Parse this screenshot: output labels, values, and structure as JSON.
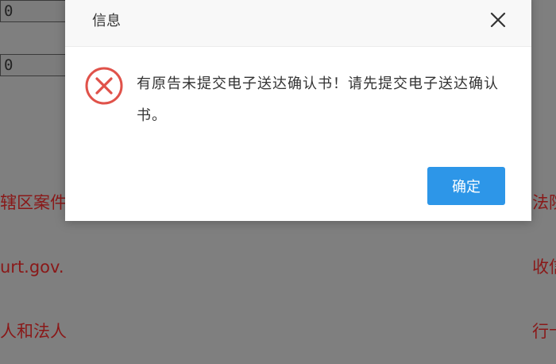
{
  "background": {
    "input_1_value": "0",
    "input_2_value": "0",
    "left_lines": [
      "辖区案件",
      "urt.gov.",
      "人和法人"
    ],
    "right_lines": [
      "法院",
      "收信",
      "行卡"
    ]
  },
  "dialog": {
    "title": "信息",
    "message": "有原告未提交电子送达确认书！请先提交电子送达确认书。",
    "confirm_label": "确定"
  },
  "icons": {
    "close": "close-icon",
    "error": "error-circle-x-icon"
  },
  "colors": {
    "error_red": "#e0524a",
    "button_blue": "#2d96e8"
  }
}
